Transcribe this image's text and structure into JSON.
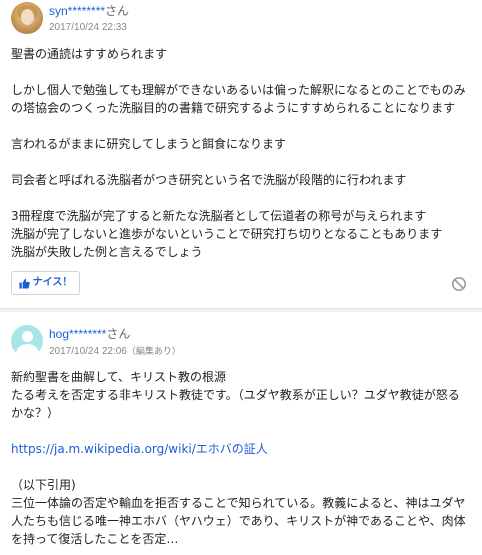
{
  "answers": [
    {
      "username": "syn********",
      "honorific": "さん",
      "datetime": "2017/10/24 22:33",
      "body_lines": [
        "聖書の通読はすすめられます",
        "",
        "しかし個人で勉強しても理解ができないあるいは偏った解釈になるとのことでものみ",
        "の塔協会のつくった洗脳目的の書籍で研究するようにすすめられることになります",
        "",
        "言われるがままに研究してしまうと餌食になります",
        "",
        "司会者と呼ばれる洗脳者がつき研究という名で洗脳が段階的に行われます",
        "",
        "3冊程度で洗脳が完了すると新たな洗脳者として伝道者の称号が与えられます",
        "洗脳が完了しないと進歩がないということで研究打ち切りとなることもあります",
        "洗脳が失敗した例と言えるでしょう"
      ],
      "nice_label": "ナイス！",
      "nice_icon": "thumbs-up-icon",
      "block_icon": "block-icon",
      "accent_color": "#1a5fd8"
    },
    {
      "username": "hog********",
      "honorific": "さん",
      "datetime": "2017/10/24 22:06",
      "edited_label": "（編集あり）",
      "body_lines": [
        "新約聖書を曲解して、キリスト教の根源",
        "たる考えを否定する非キリスト教徒です。（ユダヤ教系が正しい？ユダヤ教徒が怒る",
        "かな？）",
        "",
        "https://ja.m.wikipedia.org/wiki/エホバの証人",
        "",
        "（以下引用)",
        "三位一体論の否定や輸血を拒否することで知られている。教義によると、神はユダヤ",
        "人たちも信じる唯一神エホバ（ヤハウェ）であり、キリストが神であることや、肉体",
        "を持って復活したことを否定…"
      ],
      "link_line_index": 4,
      "link_color": "#1a5fd8"
    }
  ]
}
